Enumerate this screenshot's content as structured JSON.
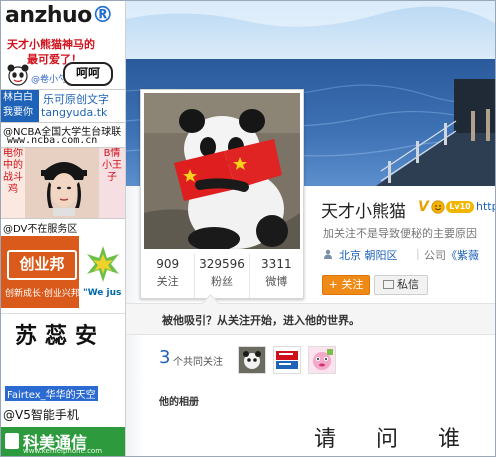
{
  "ads": {
    "logo": {
      "part1": "anzhuo",
      "part2": "®"
    },
    "panda": {
      "line1": "天才小熊猫神马的",
      "line2": "最可爱了！",
      "credit": "@卷小勺 @三分毒",
      "bubble": "呵呵"
    },
    "tang": {
      "block": "林白白 我要你",
      "line1": "乐可原创文字",
      "line2": "tangyuda.tk"
    },
    "ncba": {
      "line1": "@NCBA全国大学生台球联",
      "line2": "www.ncba.com.cn"
    },
    "mj": {
      "left": "电你中的战斗鸡",
      "right": "B情小王子"
    },
    "dv": {
      "line1": "@DV不在服务区"
    },
    "cyb": {
      "logo": "创业邦",
      "tag": "创新成长·创业兴邦"
    },
    "wj": {
      "text": "\"We jus"
    },
    "sux": {
      "text": "苏蕊安"
    },
    "fair": {
      "text": "Fairtex_华华的天空"
    },
    "v5": {
      "text": "@V5智能手机"
    },
    "km": {
      "text": "科美通信",
      "small": "www.kemeiphone.com"
    }
  },
  "profile": {
    "name": "天才小熊猫",
    "vbadge": "V",
    "vip_badge": "Lv10",
    "url_snippet": "http",
    "bio": "加关注不是导致便秘的主要原因",
    "location": "北京 朝阳区",
    "company_prefix": "公司",
    "company_link": "《紫薇",
    "stats": [
      {
        "num": "909",
        "label": "关注"
      },
      {
        "num": "329596",
        "label": "粉丝"
      },
      {
        "num": "3311",
        "label": "微博"
      }
    ],
    "follow_button": "+ 关注",
    "message_button": "私信"
  },
  "attract": {
    "text": "被他吸引？从关注开始，进入他的世界。"
  },
  "common": {
    "count": "3",
    "label": "个共同关注"
  },
  "album": {
    "title": "他的相册"
  },
  "who_text": "请问谁"
}
